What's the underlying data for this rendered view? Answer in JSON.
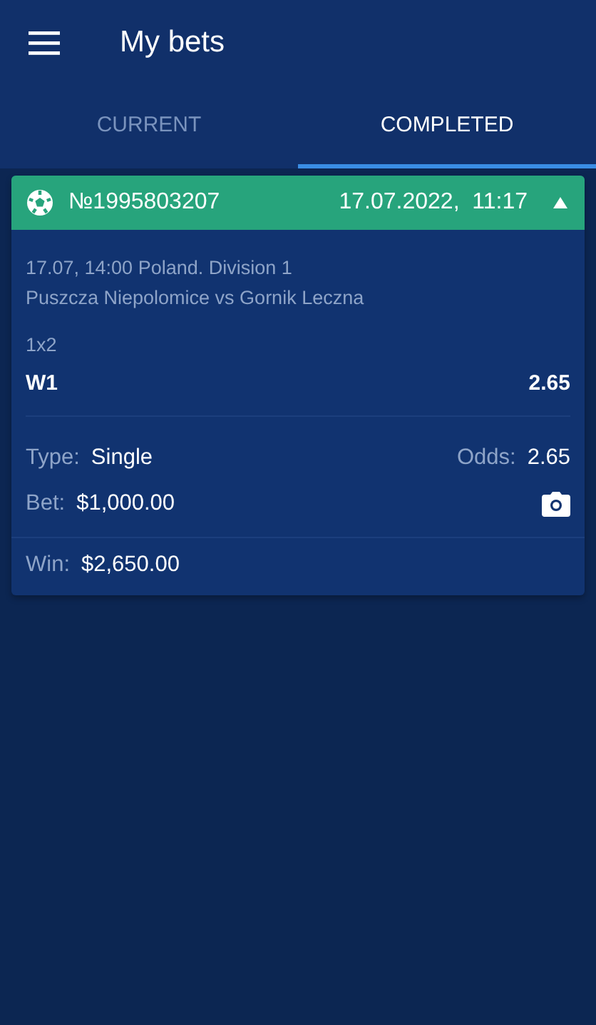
{
  "header": {
    "title": "My bets"
  },
  "tabs": [
    {
      "label": "CURRENT",
      "selected": false
    },
    {
      "label": "COMPLETED",
      "selected": true
    }
  ],
  "bet": {
    "number": "№1995803207",
    "datetime": "17.07.2022,  11:17",
    "expanded": true,
    "event": {
      "time": "17.07, 14:00",
      "league": "Poland. Division 1",
      "teams": "Puszcza Niepolomice vs Gornik Leczna",
      "market": "1x2",
      "outcome": "W1",
      "odds": "2.65"
    },
    "type_label": "Type:",
    "type": "Single",
    "odds_label": "Odds:",
    "odds": "2.65",
    "bet_label": "Bet:",
    "amount": "$1,000.00",
    "win_label": "Win:",
    "win": "$2,650.00"
  }
}
